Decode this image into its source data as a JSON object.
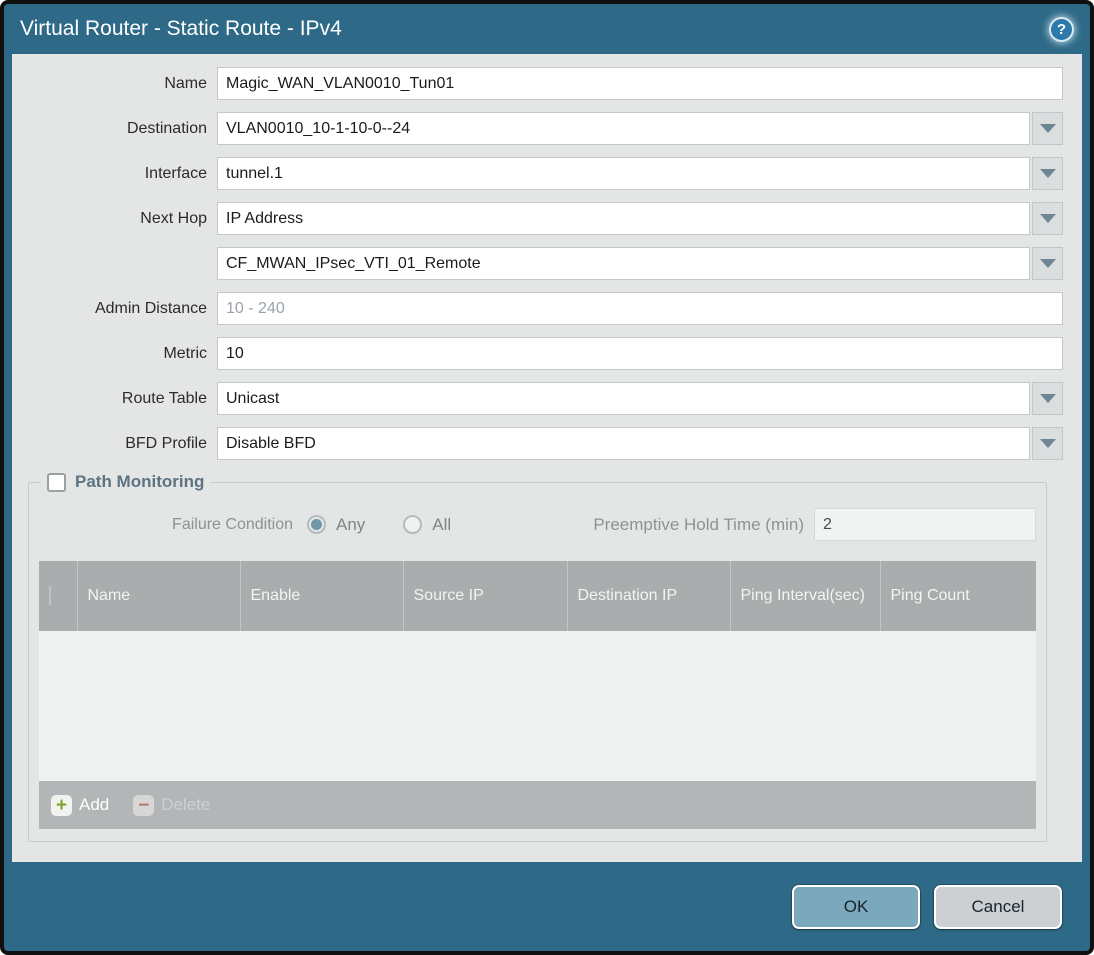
{
  "title_bar": {
    "title": "Virtual Router - Static Route - IPv4"
  },
  "icons": {
    "help": "?",
    "add": "+",
    "delete": "−"
  },
  "form": {
    "rows": [
      {
        "label": "Name",
        "value": "Magic_WAN_VLAN0010_Tun01"
      },
      {
        "label": "Destination",
        "value": "VLAN0010_10-1-10-0--24"
      },
      {
        "label": "Interface",
        "value": "tunnel.1"
      },
      {
        "label": "Next Hop",
        "value": "IP Address"
      },
      {
        "label": "",
        "value": "CF_MWAN_IPsec_VTI_01_Remote"
      },
      {
        "label": "Admin Distance",
        "placeholder": "10 - 240"
      },
      {
        "label": "Metric",
        "value": "10"
      },
      {
        "label": "Route Table",
        "value": "Unicast"
      },
      {
        "label": "BFD Profile",
        "value": "Disable BFD"
      }
    ]
  },
  "path_monitoring": {
    "legend": "Path Monitoring",
    "failure_condition": {
      "label": "Failure Condition",
      "options": [
        {
          "label": "Any",
          "selected": true
        },
        {
          "label": "All",
          "selected": false
        }
      ]
    },
    "preemptive_hold_time": {
      "label": "Preemptive Hold Time (min)",
      "value": "2"
    },
    "table": {
      "columns": [
        "Name",
        "Enable",
        "Source IP",
        "Destination IP",
        "Ping Interval(sec)",
        "Ping Count"
      ]
    },
    "toolbar": {
      "add_label": "Add",
      "delete_label": "Delete"
    }
  },
  "footer": {
    "ok_label": "OK",
    "cancel_label": "Cancel"
  },
  "colors": {
    "frame": "#2e6a87",
    "content_bg": "#e4e6e6",
    "table_header_bg": "#a9adae",
    "ok_button_bg": "#7ba8bd",
    "cancel_button_bg": "#ccd0d2",
    "radio_accent": "#6f97a9",
    "add_icon_green": "#7fa231",
    "delete_icon_red": "#b4796d"
  }
}
